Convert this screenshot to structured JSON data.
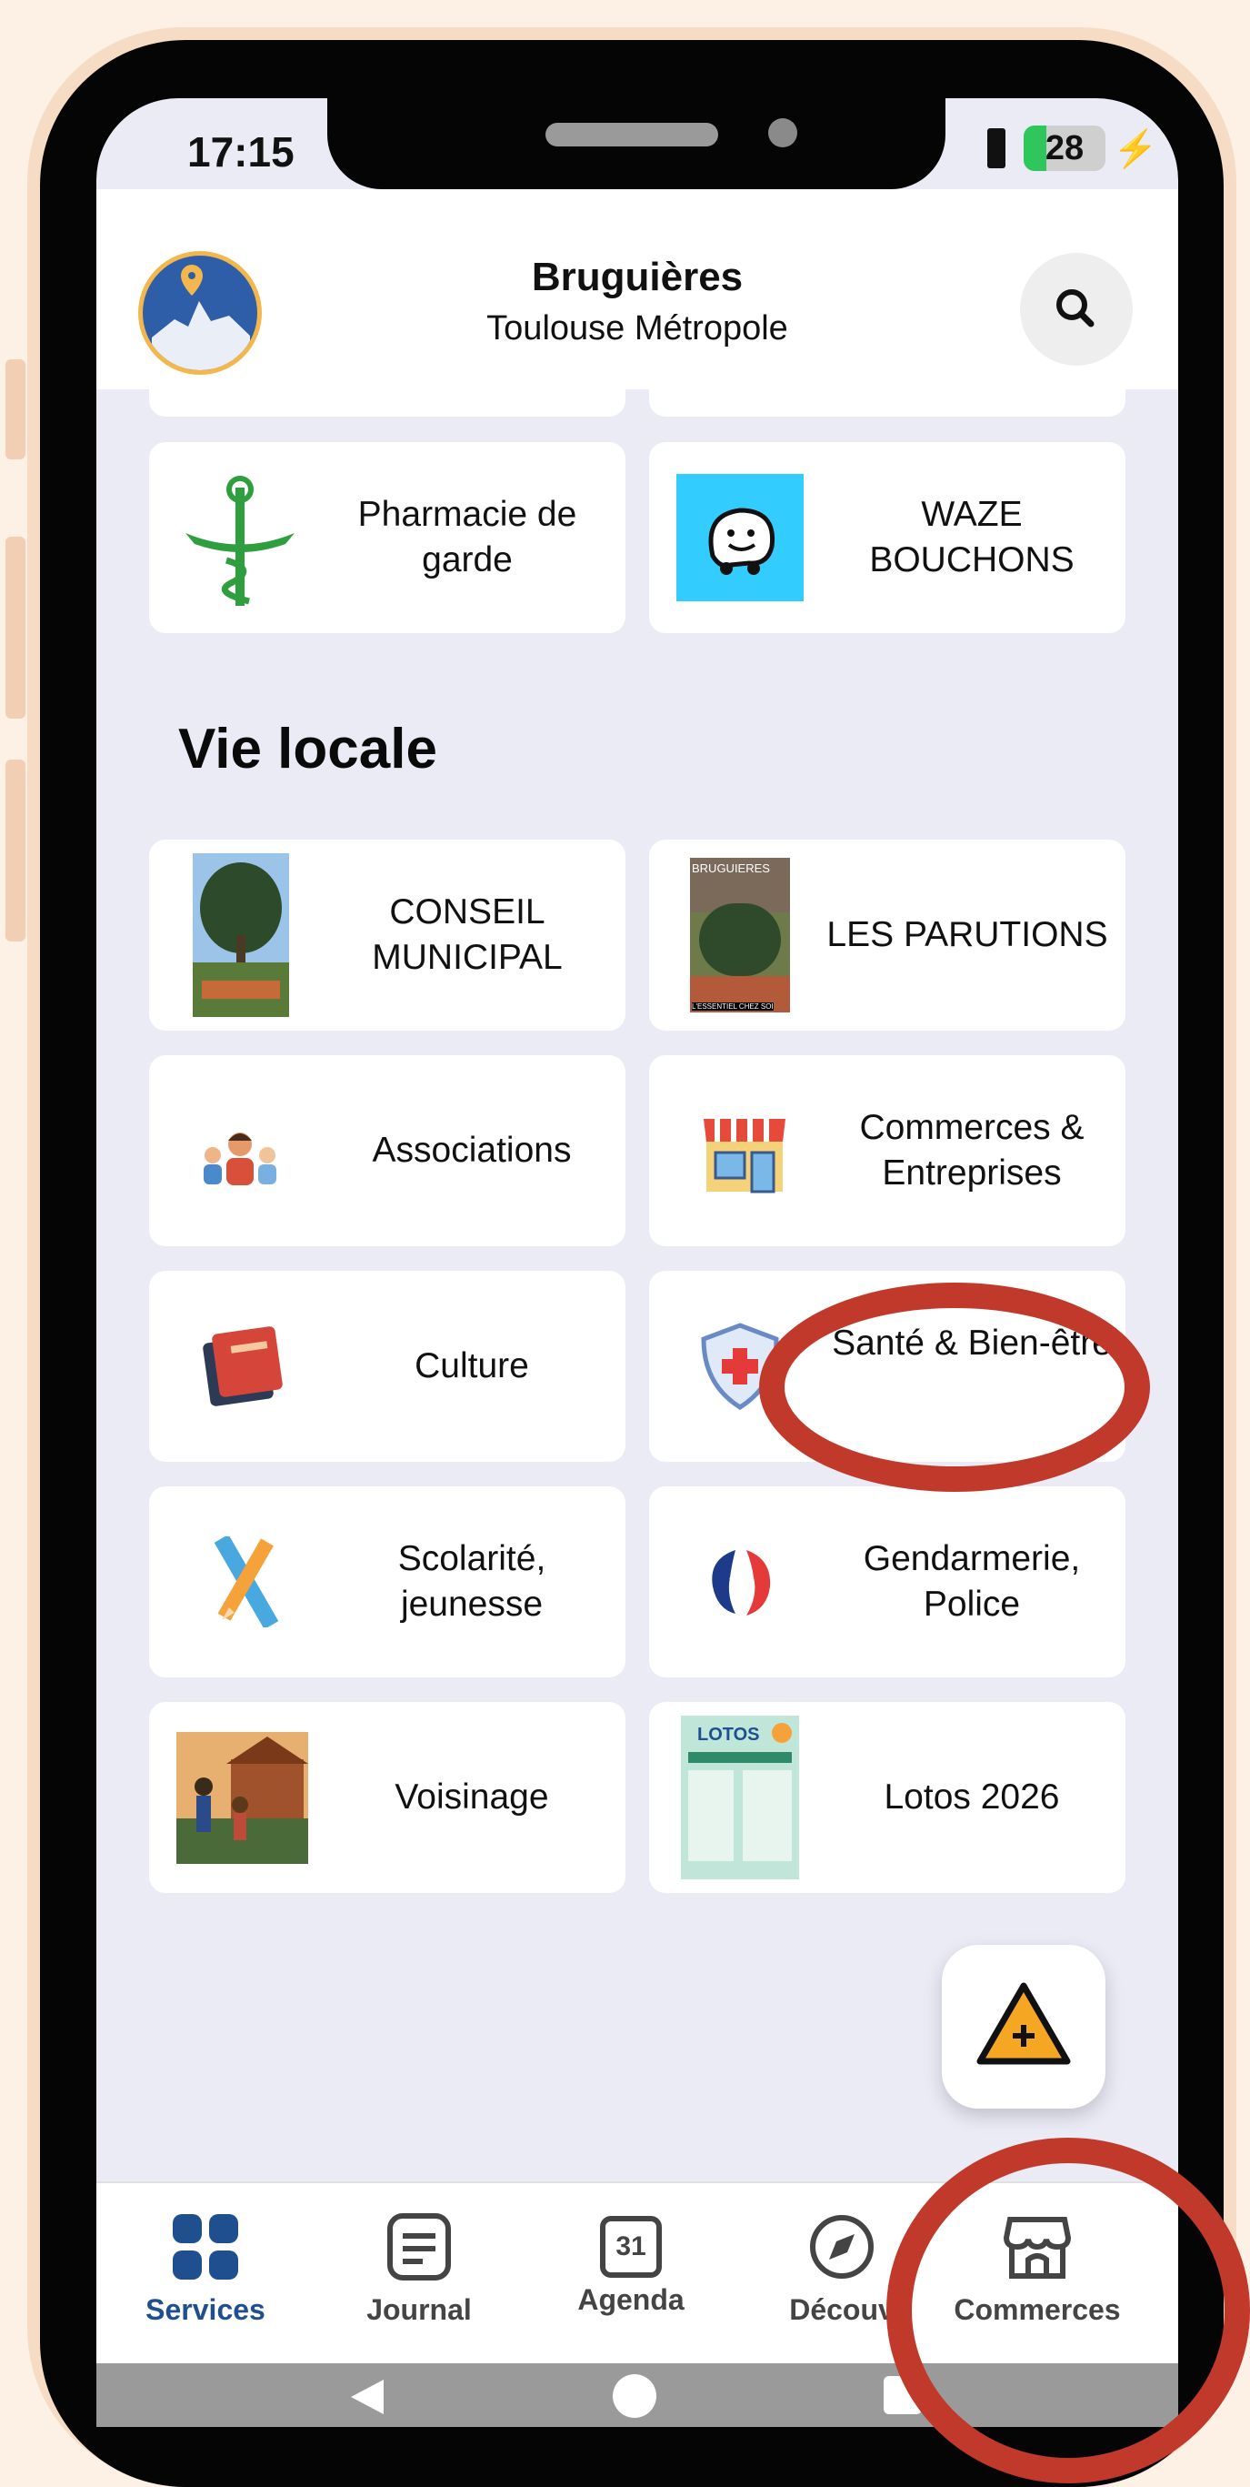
{
  "status": {
    "time": "17:15",
    "battery": "28"
  },
  "header": {
    "title": "Bruguières",
    "subtitle": "Toulouse Métropole"
  },
  "top_cards": [
    {
      "label": "Pharmacie de garde",
      "icon": "pharmacy-caduceus-icon"
    },
    {
      "label": "WAZE BOUCHONS",
      "icon": "waze-icon"
    }
  ],
  "section": {
    "title": "Vie locale"
  },
  "cards": [
    {
      "label": "CONSEIL MUNICIPAL",
      "icon": "conseil-municipal-thumbnail"
    },
    {
      "label": "LES PARUTIONS",
      "icon": "parutions-thumbnail",
      "thumb_text_top": "BRUGUIERES",
      "thumb_text_bottom": "L'ESSENTIEL CHEZ SOI"
    },
    {
      "label": "Associations",
      "icon": "people-icon"
    },
    {
      "label": "Commerces & Entreprises",
      "icon": "shop-icon"
    },
    {
      "label": "Culture",
      "icon": "book-icon"
    },
    {
      "label": "Santé & Bien-être",
      "icon": "health-shield-icon"
    },
    {
      "label": "Scolarité, jeunesse",
      "icon": "pencil-ruler-icon"
    },
    {
      "label": "Gendarmerie, Police",
      "icon": "marianne-icon"
    },
    {
      "label": "Voisinage",
      "icon": "neighborhood-thumbnail"
    },
    {
      "label": "Lotos 2026",
      "icon": "lotos-poster-thumbnail",
      "thumb_text": "LOTOS"
    }
  ],
  "nav": [
    {
      "label": "Services",
      "icon": "grid-icon",
      "active": true
    },
    {
      "label": "Journal",
      "icon": "journal-icon",
      "active": false
    },
    {
      "label": "Agenda",
      "icon": "calendar-icon",
      "day": "31",
      "active": false
    },
    {
      "label": "Découv",
      "icon": "compass-icon",
      "active": false
    },
    {
      "label": "Commerces",
      "icon": "storefront-icon",
      "active": false
    }
  ],
  "colors": {
    "accent": "#1f4f8f",
    "highlight": "#c0392b",
    "background": "#ebebf6",
    "frame": "#fdf1e6"
  }
}
